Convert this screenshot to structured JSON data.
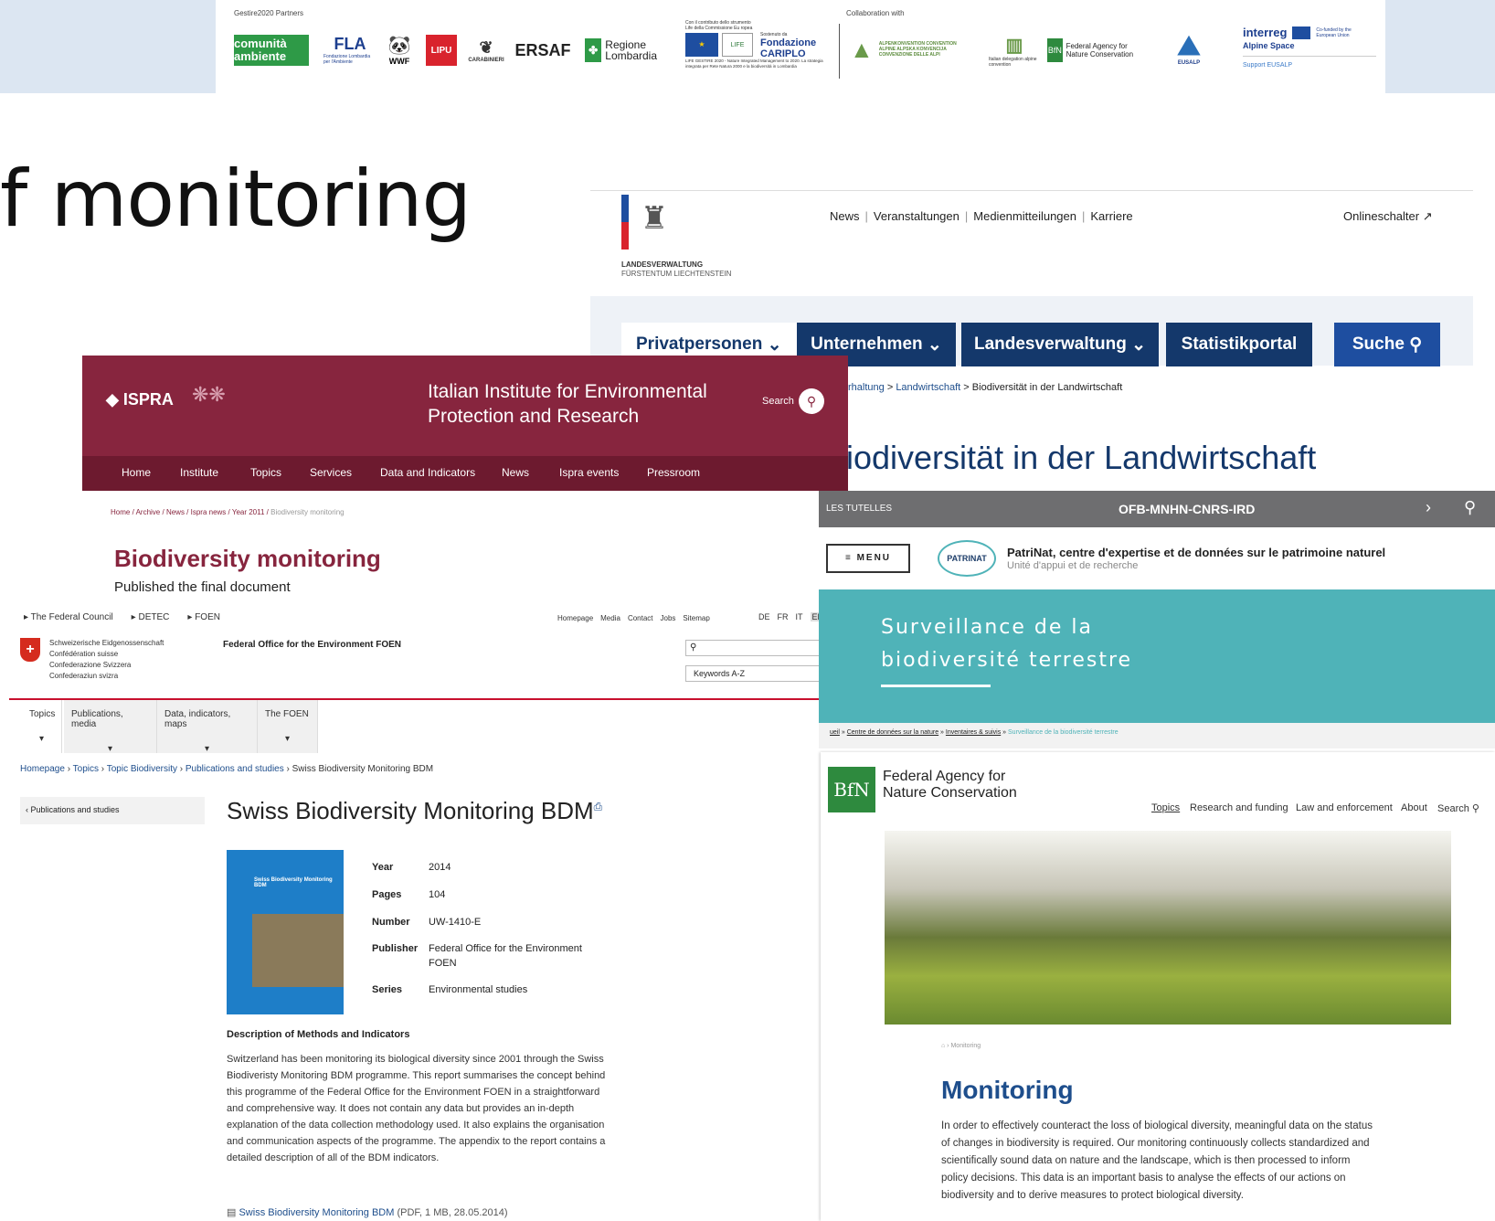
{
  "banner": {
    "partners_label": "Gestire2020 Partners",
    "collab_label": "Collaboration with",
    "logos": [
      "comunità ambiente",
      "FLA",
      "WWF",
      "LIPU",
      "CARABINIERI",
      "ERSAF",
      "Regione Lombardia",
      "LIFE",
      "Fondazione CARIPLO",
      "Alpine Convention",
      "Italian delegation alpine convention",
      "Federal Agency for Nature Conservation",
      "EUSALP",
      "interreg Alpine Space"
    ],
    "fla_sub": "Fondazione Lombardia per l'Ambiente",
    "life_text": "Con il contributo dello strumento Life della Commissione Eu ropea",
    "life_sub": "LIFE GESTIRE 2020 - Nature Integrated Management to 2020. La strategia integrata per Rete Natura 2000 e la biodiversità in Lombardia",
    "cariplo_pre": "Sostenuto da",
    "alpconv_text": "ALPENKONVENTION CONVENTION ALPINE ALPSKA KONVENCIJA CONVENZIONE DELLE ALPI",
    "interreg_cofunded": "Co-funded by the European Union",
    "interreg_support": "Support EUSALP"
  },
  "slide_title": "f monitoring",
  "liechtenstein": {
    "org_line1": "LANDESVERWALTUNG",
    "org_line2": "FÜRSTENTUM LIECHTENSTEIN",
    "top_links": [
      "News",
      "Veranstaltungen",
      "Medienmitteilungen",
      "Karriere"
    ],
    "online": "Onlineschalter ↗",
    "tabs": [
      "Privatpersonen",
      "Unternehmen",
      "Landesverwaltung",
      "Statistikportal"
    ],
    "search": "Suche",
    "breadcrumb": [
      "rhaltung",
      "Landwirtschaft",
      "Biodiversität in der Landwirtschaft"
    ],
    "page_title": "iodiversität in der Landwirtschaft"
  },
  "ispra": {
    "logo": "ISPRA",
    "title_line1": "Italian Institute for Environmental",
    "title_line2": "Protection and Research",
    "search": "Search",
    "nav": [
      "Home",
      "Institute",
      "Topics",
      "Services",
      "Data and Indicators",
      "News",
      "Ispra events",
      "Pressroom"
    ],
    "breadcrumb": [
      "Home",
      "Archive",
      "News",
      "Ispra news",
      "Year 2011",
      "Biodiversity monitoring"
    ],
    "heading": "Biodiversity monitoring",
    "subheading": "Published the final document"
  },
  "foen": {
    "crumbs": [
      "The Federal Council",
      "DETEC",
      "FOEN"
    ],
    "top_links": [
      "Homepage",
      "Media",
      "Contact",
      "Jobs",
      "Sitemap"
    ],
    "langs": [
      "DE",
      "FR",
      "IT",
      "EN"
    ],
    "confed": [
      "Schweizerische Eidgenossenschaft",
      "Confédération suisse",
      "Confederazione Svizzera",
      "Confederaziun svizra"
    ],
    "office": "Federal Office for the Environment FOEN",
    "keywords": "Keywords A-Z",
    "tabs": [
      "Topics",
      "Publications, media",
      "Data, indicators, maps",
      "The FOEN"
    ],
    "breadcrumb": [
      "Homepage",
      "Topics",
      "Topic Biodiversity",
      "Publications and studies",
      "Swiss Biodiversity Monitoring BDM"
    ],
    "back": "Publications and studies",
    "title": "Swiss Biodiversity Monitoring BDM",
    "cover_title": "Swiss Biodiversity Monitoring BDM",
    "meta": [
      {
        "k": "Year",
        "v": "2014"
      },
      {
        "k": "Pages",
        "v": "104"
      },
      {
        "k": "Number",
        "v": "UW-1410-E"
      },
      {
        "k": "Publisher",
        "v": "Federal Office for the Environment FOEN"
      },
      {
        "k": "Series",
        "v": "Environmental studies"
      }
    ],
    "desc_heading": "Description of Methods and Indicators",
    "desc": "Switzerland has been monitoring its biological diversity since 2001 through the Swiss Biodiveristy Monitoring BDM programme. This report summarises the concept behind this programme of the Federal Office for the Environment FOEN in a straightforward and comprehensive way. It does not contain any data but provides an in-depth explanation of the data collection methodology used. It also explains the organisation and communication aspects of the programme. The appendix to the report contains a detailed description of all of the BDM indicators.",
    "download_link": "Swiss Biodiversity Monitoring BDM",
    "download_meta": "(PDF, 1 MB, 28.05.2014)"
  },
  "patrinat": {
    "tutelles": "LES TUTELLES",
    "partners": "OFB-MNHN-CNRS-IRD",
    "menu": "MENU",
    "logo": "PATRINAT",
    "title": "PatriNat, centre d'expertise et de données sur le patrimoine naturel",
    "subtitle": "Unité d'appui et de recherche",
    "banner_line1": "Surveillance de la",
    "banner_line2": "biodiversité terrestre",
    "breadcrumb": [
      "ueil",
      "Centre de données sur la nature",
      "Inventaires & suivis",
      "Surveillance de la biodiversité terrestre"
    ]
  },
  "bfn": {
    "logo": "BfN",
    "name_line1": "Federal Agency for",
    "name_line2": "Nature Conservation",
    "nav": [
      "Topics",
      "Research and funding",
      "Law and enforcement",
      "About",
      "Search"
    ],
    "breadcrumb": "Monitoring",
    "heading": "Monitoring",
    "body": "In order to effectively counteract the loss of biological diversity, meaningful data on the status of changes in biodiversity is required. Our monitoring continuously collects standardized and scientifically sound data on nature and the landscape, which is then processed to inform policy decisions. This data is an important basis to analyse the effects of our actions on biodiversity and to derive measures to protect biological diversity."
  }
}
